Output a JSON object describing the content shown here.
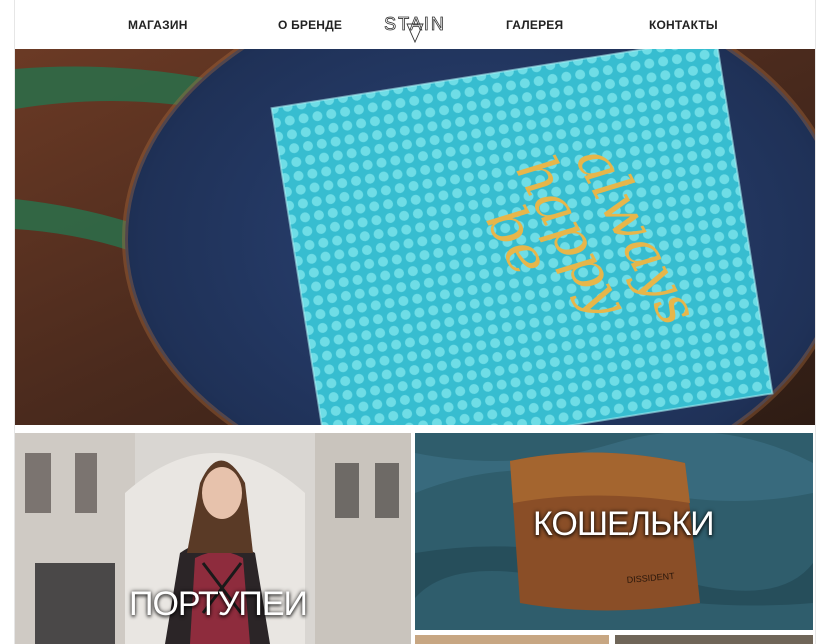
{
  "nav": {
    "items": [
      {
        "label": "МАГАЗИН"
      },
      {
        "label": "О БРЕНДЕ"
      },
      {
        "label": "ГАЛЕРЕЯ"
      },
      {
        "label": "КОНТАКТЫ"
      }
    ],
    "logo_text": "STAIN"
  },
  "hero": {
    "card_text": [
      "be",
      "happy",
      "always"
    ],
    "colors": {
      "card": "#3ec9d6",
      "lettering": "#e7b64a",
      "stool": "#233a66"
    }
  },
  "categories": [
    {
      "title": "ПОРТУПЕИ",
      "image": "woman-harness-photo"
    },
    {
      "title": "КОШЕЛЬКИ",
      "image": "leather-wallet-photo",
      "stamp": "DISSIDENT"
    }
  ]
}
